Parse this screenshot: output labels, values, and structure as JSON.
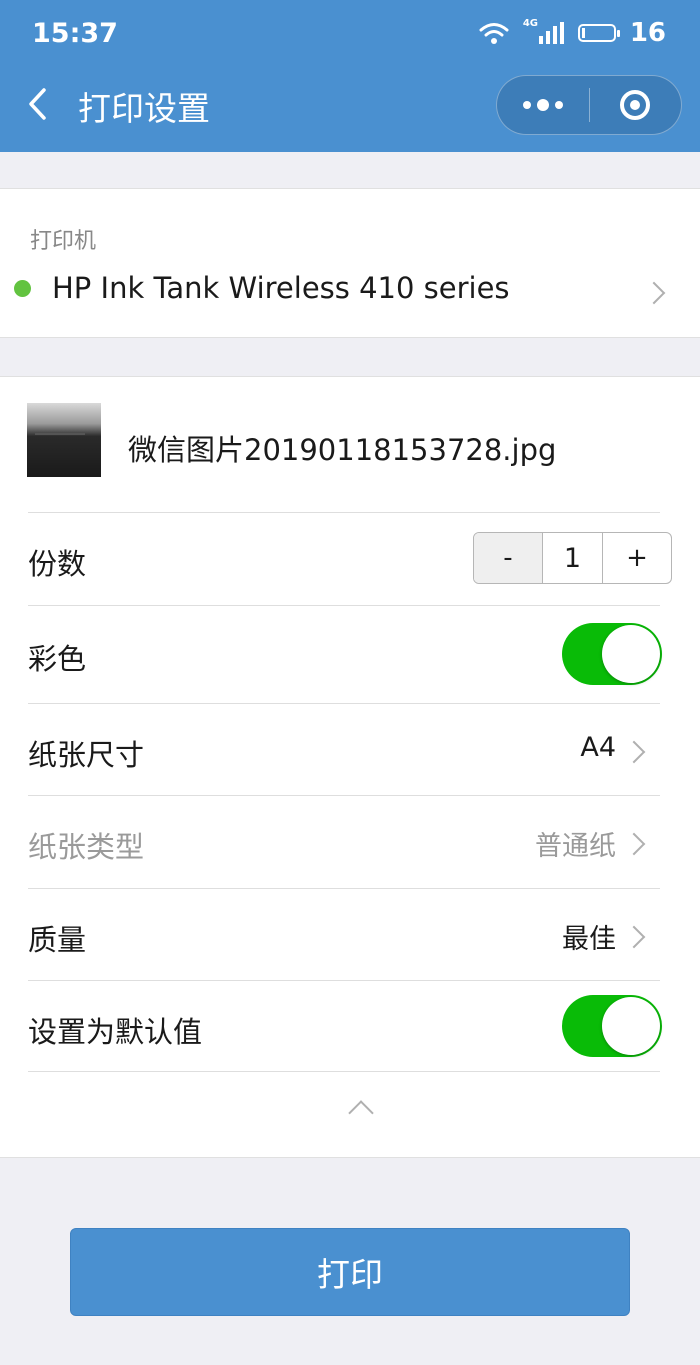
{
  "status_bar": {
    "time": "15:37",
    "network_tag": "4G",
    "battery_level": "16"
  },
  "nav": {
    "title": "打印设置"
  },
  "printer": {
    "label": "打印机",
    "name": "HP Ink Tank Wireless 410 series",
    "status_color": "#62c340"
  },
  "file": {
    "name": "微信图片20190118153728.jpg"
  },
  "settings": {
    "copies": {
      "label": "份数",
      "minus": "-",
      "value": "1",
      "plus": "+"
    },
    "color": {
      "label": "彩色",
      "enabled": true
    },
    "paper_size": {
      "label": "纸张尺寸",
      "value": "A4"
    },
    "paper_type": {
      "label": "纸张类型",
      "value": "普通纸",
      "disabled": true
    },
    "quality": {
      "label": "质量",
      "value": "最佳"
    },
    "set_default": {
      "label": "设置为默认值",
      "enabled": true
    }
  },
  "print_button": {
    "label": "打印"
  },
  "colors": {
    "header": "#4a90d0",
    "switch_on": "#09bb07",
    "primary_button": "#4a90d0"
  }
}
